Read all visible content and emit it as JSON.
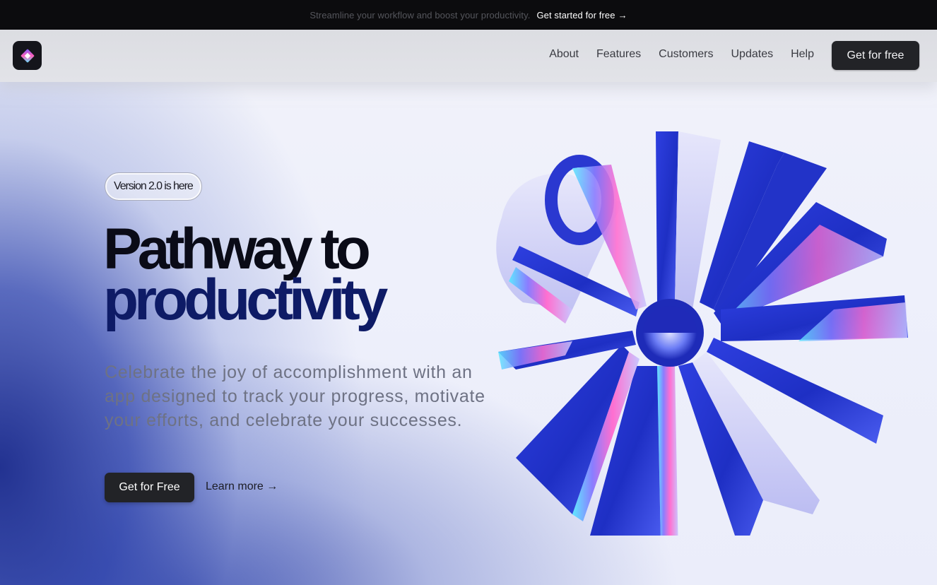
{
  "announcement": {
    "text": "Streamline your workflow and boost your productivity.",
    "cta_label": "Get started for free",
    "cta_arrow": "→"
  },
  "nav": {
    "links": [
      {
        "label": "About"
      },
      {
        "label": "Features"
      },
      {
        "label": "Customers"
      },
      {
        "label": "Updates"
      },
      {
        "label": "Help"
      }
    ],
    "cta_label": "Get for free"
  },
  "hero": {
    "badge": "Version 2.0 is here",
    "headline_line1": "Pathway to",
    "headline_line2": "productivity",
    "subcopy": "Celebrate the joy of accomplishment with an app designed to track your progress, motivate your efforts, and celebrate your successes.",
    "primary_cta": "Get for Free",
    "secondary_cta": "Learn more →"
  },
  "colors": {
    "accent_blue": "#2b3fd6",
    "dark": "#222327",
    "headline_navy": "#0e1b66"
  },
  "icons": {
    "logo": "diamond-logo-icon",
    "hero": "3d-starburst-illustration"
  }
}
